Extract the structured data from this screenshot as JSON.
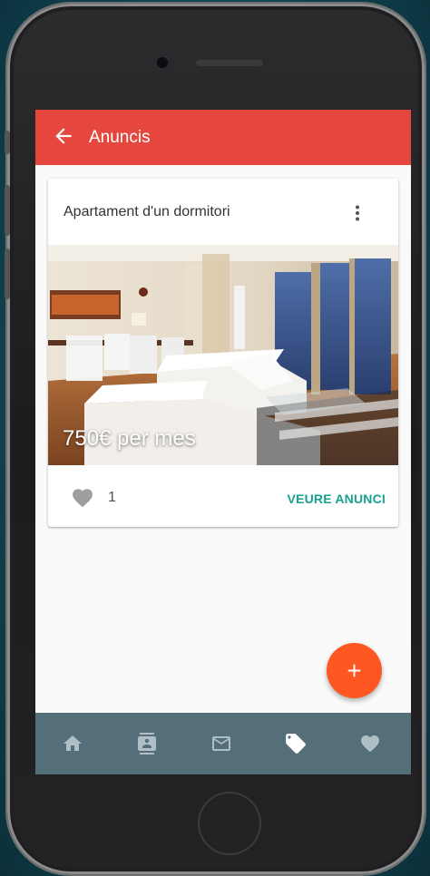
{
  "app": {
    "title": "Anuncis"
  },
  "listing": {
    "title": "Apartament d'un dormitori",
    "price": "750€ per mes",
    "likes": "1",
    "action_label": "VEURE ANUNCI"
  },
  "bottom_nav": {
    "items": [
      {
        "icon": "home-icon",
        "active": false
      },
      {
        "icon": "contact-card-icon",
        "active": false
      },
      {
        "icon": "mail-icon",
        "active": false
      },
      {
        "icon": "tag-icon",
        "active": true
      },
      {
        "icon": "heart-icon",
        "active": false
      }
    ]
  },
  "colors": {
    "appbar": "#e5473f",
    "fab": "#ff5722",
    "bottom_nav": "#546e7a",
    "accent_text": "#17a190"
  }
}
